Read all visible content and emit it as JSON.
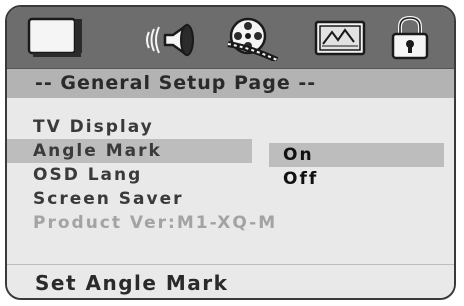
{
  "icon_bar": {
    "icons": [
      "tv-display-icon",
      "audio-speaker-icon",
      "video-film-icon",
      "preference-panel-icon",
      "password-lock-icon"
    ]
  },
  "page": {
    "title": "-- General Setup Page --"
  },
  "menu": {
    "items": [
      {
        "label": "TV Display",
        "state": "normal"
      },
      {
        "label": "Angle Mark",
        "state": "selected"
      },
      {
        "label": "OSD Lang",
        "state": "normal"
      },
      {
        "label": "Screen Saver",
        "state": "normal"
      },
      {
        "label": "Product Ver:M1-XQ-M",
        "state": "disabled"
      }
    ]
  },
  "options": {
    "items": [
      {
        "label": "On",
        "state": "highlighted"
      },
      {
        "label": "Off",
        "state": "normal"
      }
    ]
  },
  "status": {
    "text": "Set Angle Mark"
  },
  "colors": {
    "icon_bar_bg": "#6d6d6d",
    "title_bar_bg": "#b3b3b3",
    "panel_bg": "#e9e9e9",
    "highlight_bg": "#bdbdbd",
    "text": "#2a2a2a",
    "disabled_text": "#a3a3a3"
  }
}
